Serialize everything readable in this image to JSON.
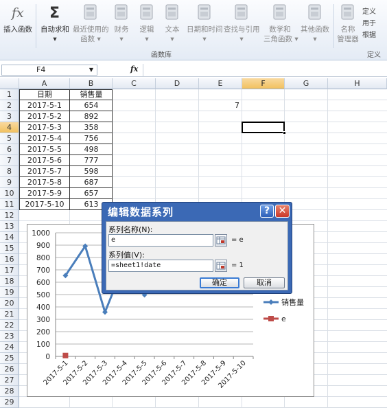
{
  "ribbon": {
    "buttons": [
      {
        "label": "插入函数",
        "label2": "",
        "icon": "function-fx-icon",
        "disabled": false
      },
      {
        "label": "自动求和",
        "label2": "▾",
        "icon": "sigma-icon",
        "disabled": false
      },
      {
        "label": "最近使用的",
        "label2": "函数 ▾",
        "icon": "recent-functions-icon",
        "disabled": true
      },
      {
        "label": "财务",
        "label2": "▾",
        "icon": "financial-icon",
        "disabled": true
      },
      {
        "label": "逻辑",
        "label2": "▾",
        "icon": "logical-icon",
        "disabled": true
      },
      {
        "label": "文本",
        "label2": "▾",
        "icon": "text-icon",
        "disabled": true
      },
      {
        "label": "日期和时间",
        "label2": "▾",
        "icon": "date-time-icon",
        "disabled": true
      },
      {
        "label": "查找与引用",
        "label2": "▾",
        "icon": "lookup-icon",
        "disabled": true
      },
      {
        "label": "数学和",
        "label2": "三角函数 ▾",
        "icon": "math-trig-icon",
        "disabled": true
      },
      {
        "label": "其他函数",
        "label2": "▾",
        "icon": "more-functions-icon",
        "disabled": true
      },
      {
        "label": "名称",
        "label2": "管理器",
        "icon": "name-manager-icon",
        "disabled": true
      }
    ],
    "group_label": "函数库",
    "group_label2": "定义的",
    "small_items": [
      "定义",
      "用于",
      "根据"
    ]
  },
  "formula_bar": {
    "name_box": "F4",
    "fx": "fx",
    "content": ""
  },
  "columns": [
    "A",
    "B",
    "C",
    "D",
    "E",
    "F",
    "G",
    "H"
  ],
  "rows": [
    "1",
    "2",
    "3",
    "4",
    "5",
    "6",
    "7",
    "8",
    "9",
    "10",
    "11",
    "12",
    "13",
    "14",
    "15",
    "16",
    "17",
    "18",
    "19",
    "20",
    "21",
    "22",
    "23",
    "24",
    "25",
    "26",
    "27",
    "28",
    "29"
  ],
  "sheet": {
    "header_a": "日期",
    "header_b": "销售量",
    "dates": [
      "2017-5-1",
      "2017-5-2",
      "2017-5-3",
      "2017-5-4",
      "2017-5-5",
      "2017-5-6",
      "2017-5-7",
      "2017-5-8",
      "2017-5-9",
      "2017-5-10"
    ],
    "sales": [
      "654",
      "892",
      "358",
      "756",
      "498",
      "777",
      "598",
      "687",
      "657",
      "613"
    ],
    "e2": "7"
  },
  "chart_data": {
    "type": "line",
    "categories": [
      "2017-5-1",
      "2017-5-2",
      "2017-5-3",
      "2017-5-4",
      "2017-5-5",
      "2017-5-6",
      "2017-5-7",
      "2017-5-8",
      "2017-5-9",
      "2017-5-10"
    ],
    "series": [
      {
        "name": "销售量",
        "values": [
          654,
          892,
          358,
          756,
          498,
          777,
          598,
          687,
          657,
          613
        ],
        "color": "#4a7ebb"
      },
      {
        "name": "e",
        "values": [
          7
        ],
        "color": "#be4b48"
      }
    ],
    "ylim": [
      0,
      1000
    ],
    "yticks": [
      0,
      100,
      200,
      300,
      400,
      500,
      600,
      700,
      800,
      900,
      1000
    ],
    "grid": true,
    "legend": "right"
  },
  "dialog": {
    "title": "编辑数据系列",
    "help": "?",
    "close": "✕",
    "name_label": "系列名称(N):",
    "name_value": "e",
    "name_preview": "= e",
    "values_label": "系列值(V):",
    "values_value": "=sheet1!date",
    "values_preview": "= 1",
    "ok": "确定",
    "cancel": "取消"
  }
}
